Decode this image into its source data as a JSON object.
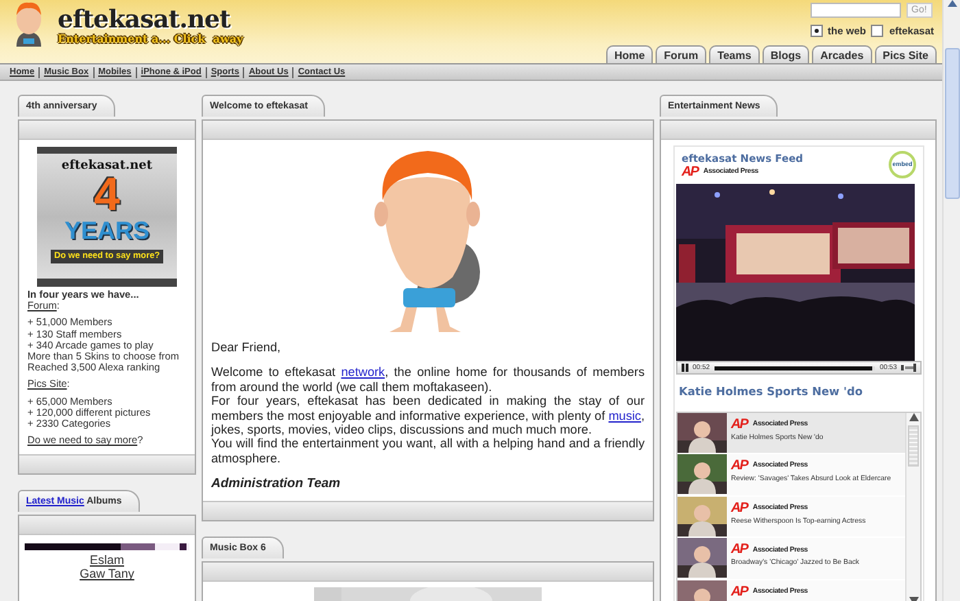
{
  "header": {
    "site_title": "eftekasat.net",
    "tagline": "Entertainment a... Click  away",
    "search": {
      "button": "Go!"
    },
    "scope": [
      {
        "label": "the web",
        "selected": true
      },
      {
        "label": "eftekasat",
        "selected": false
      }
    ],
    "tabs": [
      "Home",
      "Forum",
      "Teams",
      "Blogs",
      "Arcades",
      "Pics Site"
    ]
  },
  "nav_links": [
    "Home",
    "Music Box",
    "Mobiles",
    "iPhone & iPod",
    "Sports",
    "About Us",
    "Contact Us"
  ],
  "anniversary": {
    "title": "4th anniversary",
    "banner": {
      "site": "eftekasat.net",
      "number": "4",
      "word": "YEARS",
      "slogan": "Do we need to say more?"
    },
    "sections": [
      [
        [
          {
            "text": "In four years we have...",
            "kind": "bold"
          }
        ],
        [
          {
            "text": "Forum",
            "kind": "link"
          },
          {
            "text": ":",
            "kind": "text"
          }
        ]
      ],
      [
        [
          {
            "text": "+ 51,000 Members",
            "kind": "text"
          }
        ],
        [
          {
            "text": "+ 130 Staff members",
            "kind": "text"
          }
        ],
        [
          {
            "text": "+ 340 Arcade games to play",
            "kind": "text"
          }
        ],
        [
          {
            "text": "More than 5 Skins to choose from",
            "kind": "text"
          }
        ],
        [
          {
            "text": "Reached 3,500 Alexa ranking",
            "kind": "text"
          }
        ]
      ],
      [
        [
          {
            "text": "Pics Site",
            "kind": "link"
          },
          {
            "text": ":",
            "kind": "text"
          }
        ]
      ],
      [
        [
          {
            "text": "+ 65,000 Members",
            "kind": "text"
          }
        ],
        [
          {
            "text": "+ 120,000 different pictures",
            "kind": "text"
          }
        ],
        [
          {
            "text": "+ 2330 Categories",
            "kind": "text"
          }
        ]
      ],
      [
        [
          {
            "text": "Do we need to say more",
            "kind": "link"
          },
          {
            "text": "?",
            "kind": "text"
          }
        ]
      ]
    ]
  },
  "latest_music": {
    "title": [
      {
        "text": "Latest Music",
        "kind": "bluelink"
      },
      {
        "text": " Albums",
        "kind": "text"
      }
    ],
    "albums": [
      "Eslam",
      "Gaw Tany"
    ]
  },
  "welcome": {
    "title": "Welcome to eftekasat",
    "greeting": "Dear Friend,",
    "paragraphs": [
      [
        {
          "text": "Welcome to eftekasat ",
          "kind": "text"
        },
        {
          "text": "network",
          "kind": "bluelink"
        },
        {
          "text": ", the online home for thousands of members from around the world (we call them moftakaseen).",
          "kind": "text"
        }
      ],
      [
        {
          "text": "For four years, eftekasat has been dedicated in making the stay of our members the most enjoyable and informative experience, with plenty of ",
          "kind": "text"
        },
        {
          "text": "music",
          "kind": "bluelink"
        },
        {
          "text": ", jokes, sports, movies, video clips, discussions and much much more.",
          "kind": "text"
        }
      ],
      [
        {
          "text": "You will find the entertainment you want, all with a helping hand and a friendly atmosphere.",
          "kind": "text"
        }
      ]
    ],
    "signature": "Administration Team"
  },
  "music_box": {
    "title": "Music Box 6"
  },
  "news": {
    "title": "Entertainment News",
    "feed_title": "eftekasat News Feed",
    "logo": "AP",
    "source": "Associated Press",
    "embed": "embed",
    "player": {
      "elapsed": "00:52",
      "total": "00:53",
      "level": 0.98
    },
    "headline": "Katie Holmes Sports New 'do",
    "items": [
      {
        "logo": "AP",
        "source": "Associated Press",
        "title": "Katie Holmes Sports New 'do",
        "selected": true
      },
      {
        "logo": "AP",
        "source": "Associated Press",
        "title": "Review: 'Savages' Takes Absurd Look at Eldercare",
        "selected": false
      },
      {
        "logo": "AP",
        "source": "Associated Press",
        "title": "Reese Witherspoon Is Top-earning Actress",
        "selected": false
      },
      {
        "logo": "AP",
        "source": "Associated Press",
        "title": "Broadway's 'Chicago' Jazzed to Be Back",
        "selected": false
      },
      {
        "logo": "AP",
        "source": "Associated Press",
        "selected": false
      }
    ]
  }
}
